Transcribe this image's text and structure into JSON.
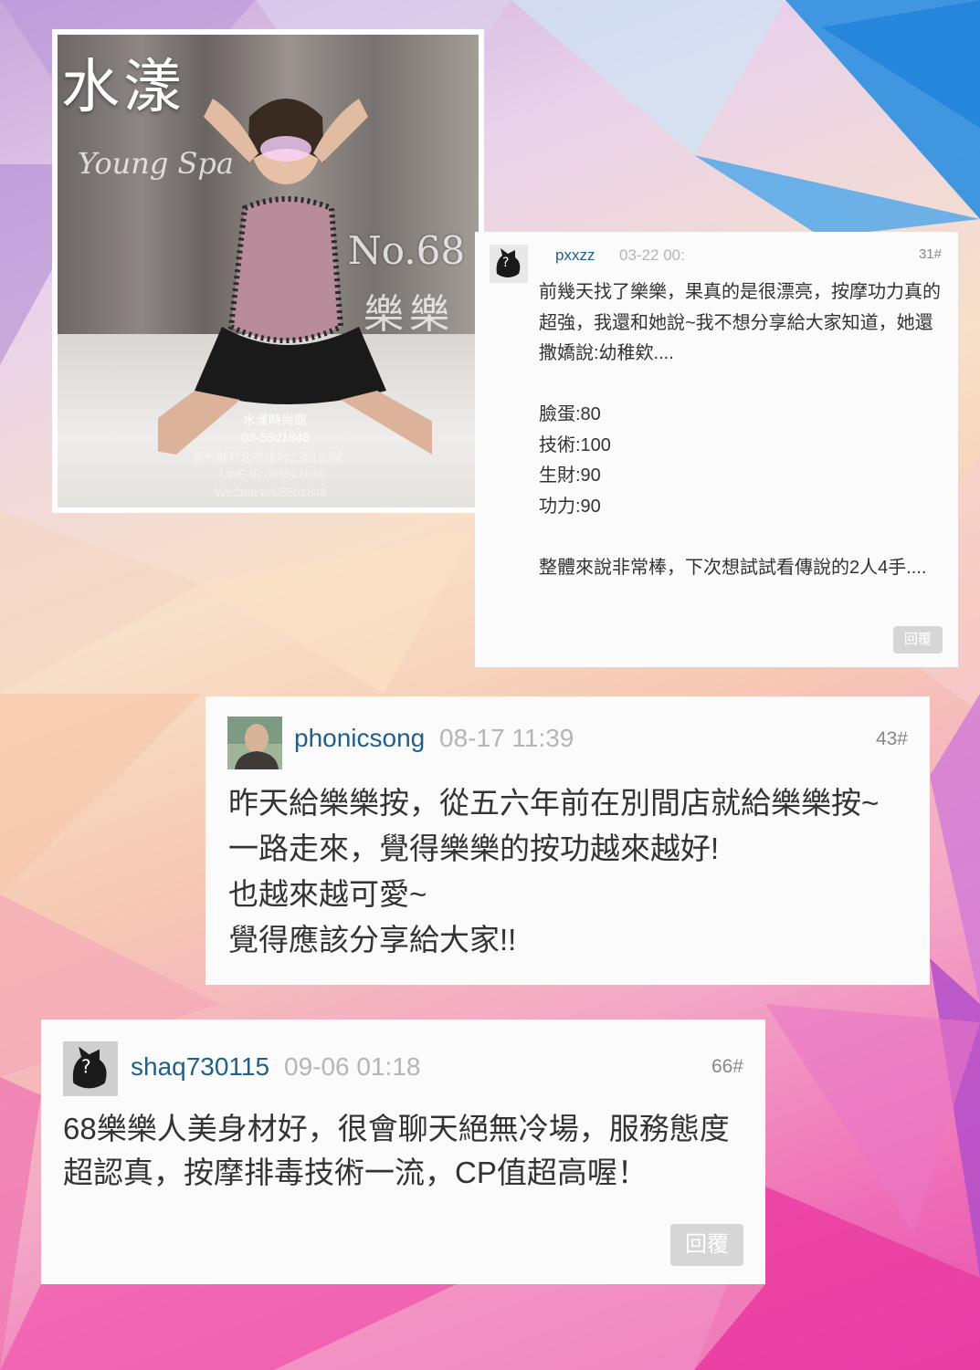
{
  "photo": {
    "brand_cn": "水漾",
    "brand_en": "Young Spa",
    "number": "No.68",
    "name": "樂樂",
    "shop": "水漾時尚館",
    "phone": "03-5501848",
    "address": "新竹縣竹北市成功二街192號",
    "line": "LINE ID:035501848",
    "wechat": "WeChat:a035501848"
  },
  "posts": [
    {
      "username": "pxxzz",
      "timestamp": "03-22 00:",
      "floor": "31#",
      "body": "前幾天找了樂樂，果真的是很漂亮，按摩功力真的超強，我還和她說~我不想分享給大家知道，她還撒嬌說:幼稚欸....\n\n臉蛋:80\n技術:100\n生財:90\n功力:90\n\n整體來說非常棒，下次想試試看傳說的2人4手....",
      "reply_label": "回覆",
      "avatar_icon": "black-cat-avatar-icon"
    },
    {
      "username": "phonicsong",
      "timestamp": "08-17 11:39",
      "floor": "43#",
      "body": "昨天給樂樂按，從五六年前在別間店就給樂樂按~\n一路走來，覺得樂樂的按功越來越好!\n也越來越可愛~\n覺得應該分享給大家!!",
      "avatar_icon": "monk-avatar-icon"
    },
    {
      "username": "shaq730115",
      "timestamp": "09-06 01:18",
      "floor": "66#",
      "body": "68樂樂人美身材好，很會聊天絕無冷場，服務態度超認真，按摩排毒技術一流，CP值超高喔！",
      "reply_label": "回覆",
      "avatar_icon": "black-cat-avatar-icon"
    }
  ],
  "colors": {
    "username": "#1f5f8b",
    "timestamp": "#b5b5b5",
    "card_bg": "#fbfbfb",
    "reply_button": "#d6d6d6"
  }
}
